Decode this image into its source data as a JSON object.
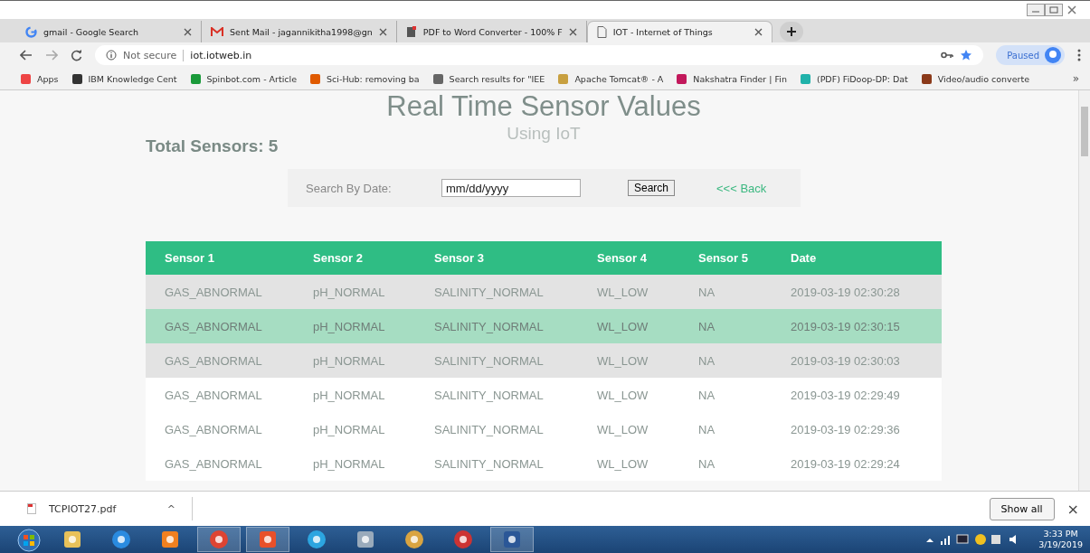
{
  "browser": {
    "tabs": [
      {
        "title": "gmail - Google Search",
        "selected": false
      },
      {
        "title": "Sent Mail - jagannikitha1998@gn",
        "selected": false
      },
      {
        "title": "PDF to Word Converter - 100% F",
        "selected": false
      },
      {
        "title": "IOT - Internet of Things",
        "selected": true
      }
    ],
    "security": "Not secure",
    "url": "iot.iotweb.in",
    "profile": "Paused",
    "bookmarks": [
      {
        "label": "Apps"
      },
      {
        "label": "IBM Knowledge Cent"
      },
      {
        "label": "Spinbot.com - Article"
      },
      {
        "label": "Sci-Hub: removing ba"
      },
      {
        "label": "Search results for \"IEE"
      },
      {
        "label": "Apache Tomcat® - A"
      },
      {
        "label": "Nakshatra Finder | Fin"
      },
      {
        "label": "(PDF) FiDoop-DP: Dat"
      },
      {
        "label": "Video/audio converte"
      }
    ],
    "more": "»"
  },
  "page": {
    "title": "Real Time Sensor Values",
    "subtitle": "Using IoT",
    "total": "Total Sensors: 5",
    "search": {
      "label": "Search By Date:",
      "placeholder": "mm/dd/yyyy",
      "button": "Search",
      "back": "<<< Back"
    },
    "table": {
      "columns": [
        "Sensor 1",
        "Sensor 2",
        "Sensor 3",
        "Sensor 4",
        "Sensor 5",
        "Date"
      ],
      "rows": [
        {
          "cells": [
            "GAS_ABNORMAL",
            "pH_NORMAL",
            "SALINITY_NORMAL",
            "WL_LOW",
            "NA",
            "2019-03-19 02:30:28"
          ],
          "selected": false,
          "shaded": true
        },
        {
          "cells": [
            "GAS_ABNORMAL",
            "pH_NORMAL",
            "SALINITY_NORMAL",
            "WL_LOW",
            "NA",
            "2019-03-19 02:30:15"
          ],
          "selected": true,
          "shaded": false
        },
        {
          "cells": [
            "GAS_ABNORMAL",
            "pH_NORMAL",
            "SALINITY_NORMAL",
            "WL_LOW",
            "NA",
            "2019-03-19 02:30:03"
          ],
          "selected": false,
          "shaded": true
        },
        {
          "cells": [
            "GAS_ABNORMAL",
            "pH_NORMAL",
            "SALINITY_NORMAL",
            "WL_LOW",
            "NA",
            "2019-03-19 02:29:49"
          ],
          "selected": false,
          "shaded": false
        },
        {
          "cells": [
            "GAS_ABNORMAL",
            "pH_NORMAL",
            "SALINITY_NORMAL",
            "WL_LOW",
            "NA",
            "2019-03-19 02:29:36"
          ],
          "selected": false,
          "shaded": false
        },
        {
          "cells": [
            "GAS_ABNORMAL",
            "pH_NORMAL",
            "SALINITY_NORMAL",
            "WL_LOW",
            "NA",
            "2019-03-19 02:29:24"
          ],
          "selected": false,
          "shaded": false
        }
      ]
    }
  },
  "downloads": {
    "file": "TCPIOT27.pdf",
    "caret": "^",
    "show_all": "Show all",
    "close": "×"
  },
  "taskbar": {
    "time": "3:33 PM",
    "date": "3/19/2019"
  }
}
